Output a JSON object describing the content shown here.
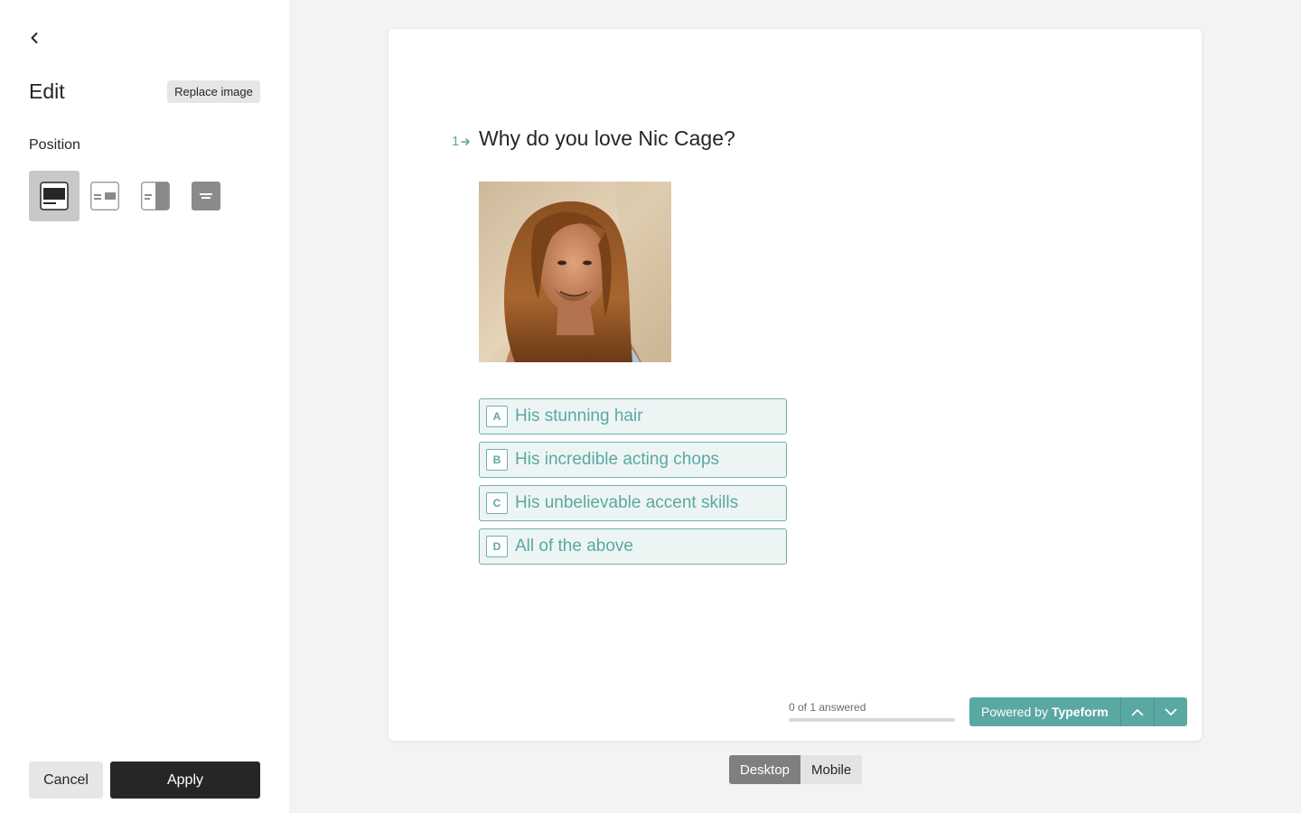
{
  "sidebar": {
    "title": "Edit",
    "replace_label": "Replace image",
    "position_label": "Position",
    "position_options": [
      "full-image",
      "image-right-small",
      "split-right",
      "background-image"
    ],
    "selected_position": 0,
    "cancel_label": "Cancel",
    "apply_label": "Apply"
  },
  "preview": {
    "question_number": "1",
    "question_text": "Why do you love Nic Cage?",
    "choices": [
      {
        "key": "A",
        "label": "His stunning hair"
      },
      {
        "key": "B",
        "label": "His incredible acting chops"
      },
      {
        "key": "C",
        "label": "His unbelievable accent skills"
      },
      {
        "key": "D",
        "label": "All of the above"
      }
    ],
    "progress_text": "0 of 1 answered",
    "progress_fraction": 0,
    "powered_prefix": "Powered by",
    "powered_brand": "Typeform"
  },
  "device_toggle": {
    "desktop_label": "Desktop",
    "mobile_label": "Mobile",
    "active": "Desktop"
  },
  "colors": {
    "accent": "#5aa8a2",
    "choice_bg": "#edf5f4",
    "dark": "#262627"
  }
}
